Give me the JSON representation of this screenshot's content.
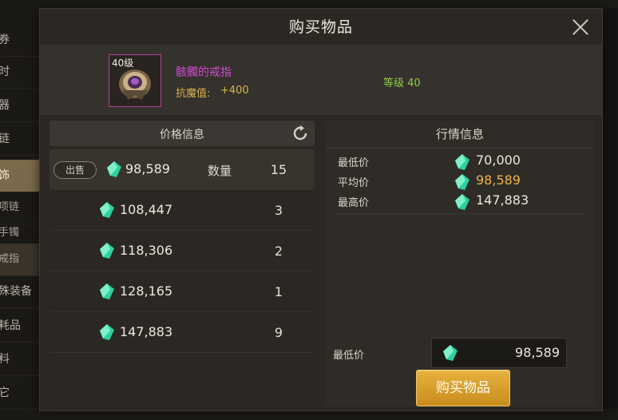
{
  "background": {
    "left_categories": [
      {
        "label": "券",
        "active": false
      },
      {
        "label": "时",
        "active": false
      },
      {
        "label": "器",
        "active": false
      },
      {
        "label": "链",
        "active": false
      },
      {
        "label": "饰",
        "active": true
      },
      {
        "label": "项链",
        "active": false,
        "sub": true
      },
      {
        "label": "手镯",
        "active": false,
        "sub": true
      },
      {
        "label": "戒指",
        "active": true,
        "sub": true
      },
      {
        "label": "殊装备",
        "active": false
      },
      {
        "label": "耗品",
        "active": false
      },
      {
        "label": "料",
        "active": false
      },
      {
        "label": "它",
        "active": false
      }
    ]
  },
  "dialog": {
    "title": "购买物品"
  },
  "item": {
    "level_badge": "40级",
    "name": "骸髑的戒指",
    "stat_label": "抗魔值:",
    "stat_value": "+400",
    "grade": "等级 40",
    "icon": "ring-icon",
    "border_color": "#b0449a",
    "name_color": "#d24bd6"
  },
  "price_panel": {
    "title": "价格信息",
    "sell_label": "出售",
    "qty_label": "数量",
    "rows": [
      {
        "price": "98,589",
        "qty": "15"
      },
      {
        "price": "108,447",
        "qty": "3"
      },
      {
        "price": "118,306",
        "qty": "2"
      },
      {
        "price": "128,165",
        "qty": "1"
      },
      {
        "price": "147,883",
        "qty": "9"
      }
    ]
  },
  "market_panel": {
    "title": "行情信息",
    "lowest_label": "最低价",
    "lowest_value": "70,000",
    "average_label": "平均价",
    "average_value": "98,589",
    "highest_label": "最高价",
    "highest_value": "147,883",
    "min_price_label": "最低价",
    "min_price_value": "98,589",
    "buy_button": "购买物品"
  },
  "colors": {
    "accent_gold": "#e0a530",
    "gem_green": "#2fd0a0",
    "average_price": "#f0b24a"
  }
}
